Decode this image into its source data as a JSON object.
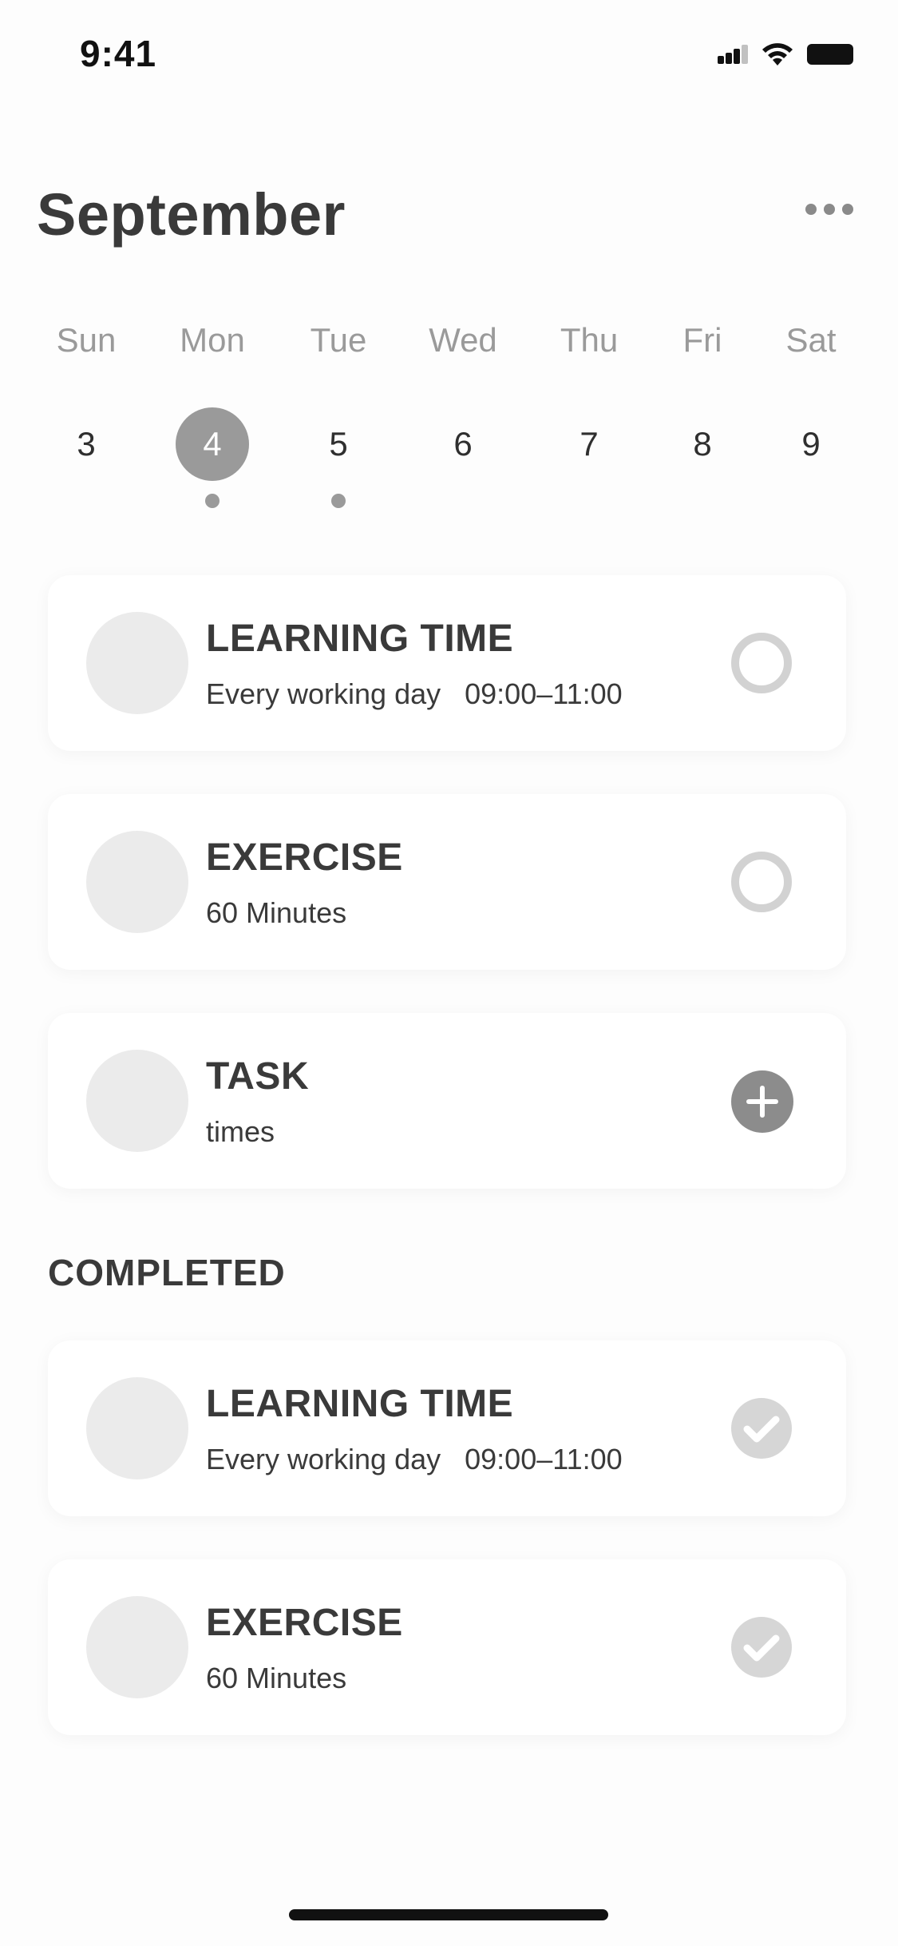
{
  "status_bar": {
    "time": "9:41",
    "icons": [
      "signal-icon",
      "wifi-icon",
      "battery-icon"
    ]
  },
  "header": {
    "month": "September",
    "more_icon": "more-horizontal-icon"
  },
  "week": {
    "days": [
      {
        "name": "Sun",
        "num": "3",
        "selected": false,
        "has_event": false
      },
      {
        "name": "Mon",
        "num": "4",
        "selected": true,
        "has_event": true
      },
      {
        "name": "Tue",
        "num": "5",
        "selected": false,
        "has_event": true
      },
      {
        "name": "Wed",
        "num": "6",
        "selected": false,
        "has_event": false
      },
      {
        "name": "Thu",
        "num": "7",
        "selected": false,
        "has_event": false
      },
      {
        "name": "Fri",
        "num": "8",
        "selected": false,
        "has_event": false
      },
      {
        "name": "Sat",
        "num": "9",
        "selected": false,
        "has_event": false
      }
    ]
  },
  "tasks": [
    {
      "title": "LEARNING TIME",
      "subtitle": "Every working day   09:00–11:00",
      "action": "circle-icon"
    },
    {
      "title": "EXERCISE",
      "subtitle": "60 Minutes",
      "action": "circle-icon"
    },
    {
      "title": "TASK",
      "subtitle": "times",
      "action": "plus-icon"
    }
  ],
  "completed": {
    "section_title": "COMPLETED",
    "items": [
      {
        "title": "LEARNING TIME",
        "subtitle": "Every working day   09:00–11:00",
        "action": "check-icon"
      },
      {
        "title": "EXERCISE",
        "subtitle": "60 Minutes",
        "action": "check-icon"
      }
    ]
  },
  "colors": {
    "text": "#3a3a3a",
    "muted": "#9a9a9a",
    "selected_day": "#9a9a9a",
    "thumb": "#ebebeb",
    "ring": "#d2d2d2",
    "add_button": "#8c8c8c",
    "check": "#d6d6d6"
  }
}
